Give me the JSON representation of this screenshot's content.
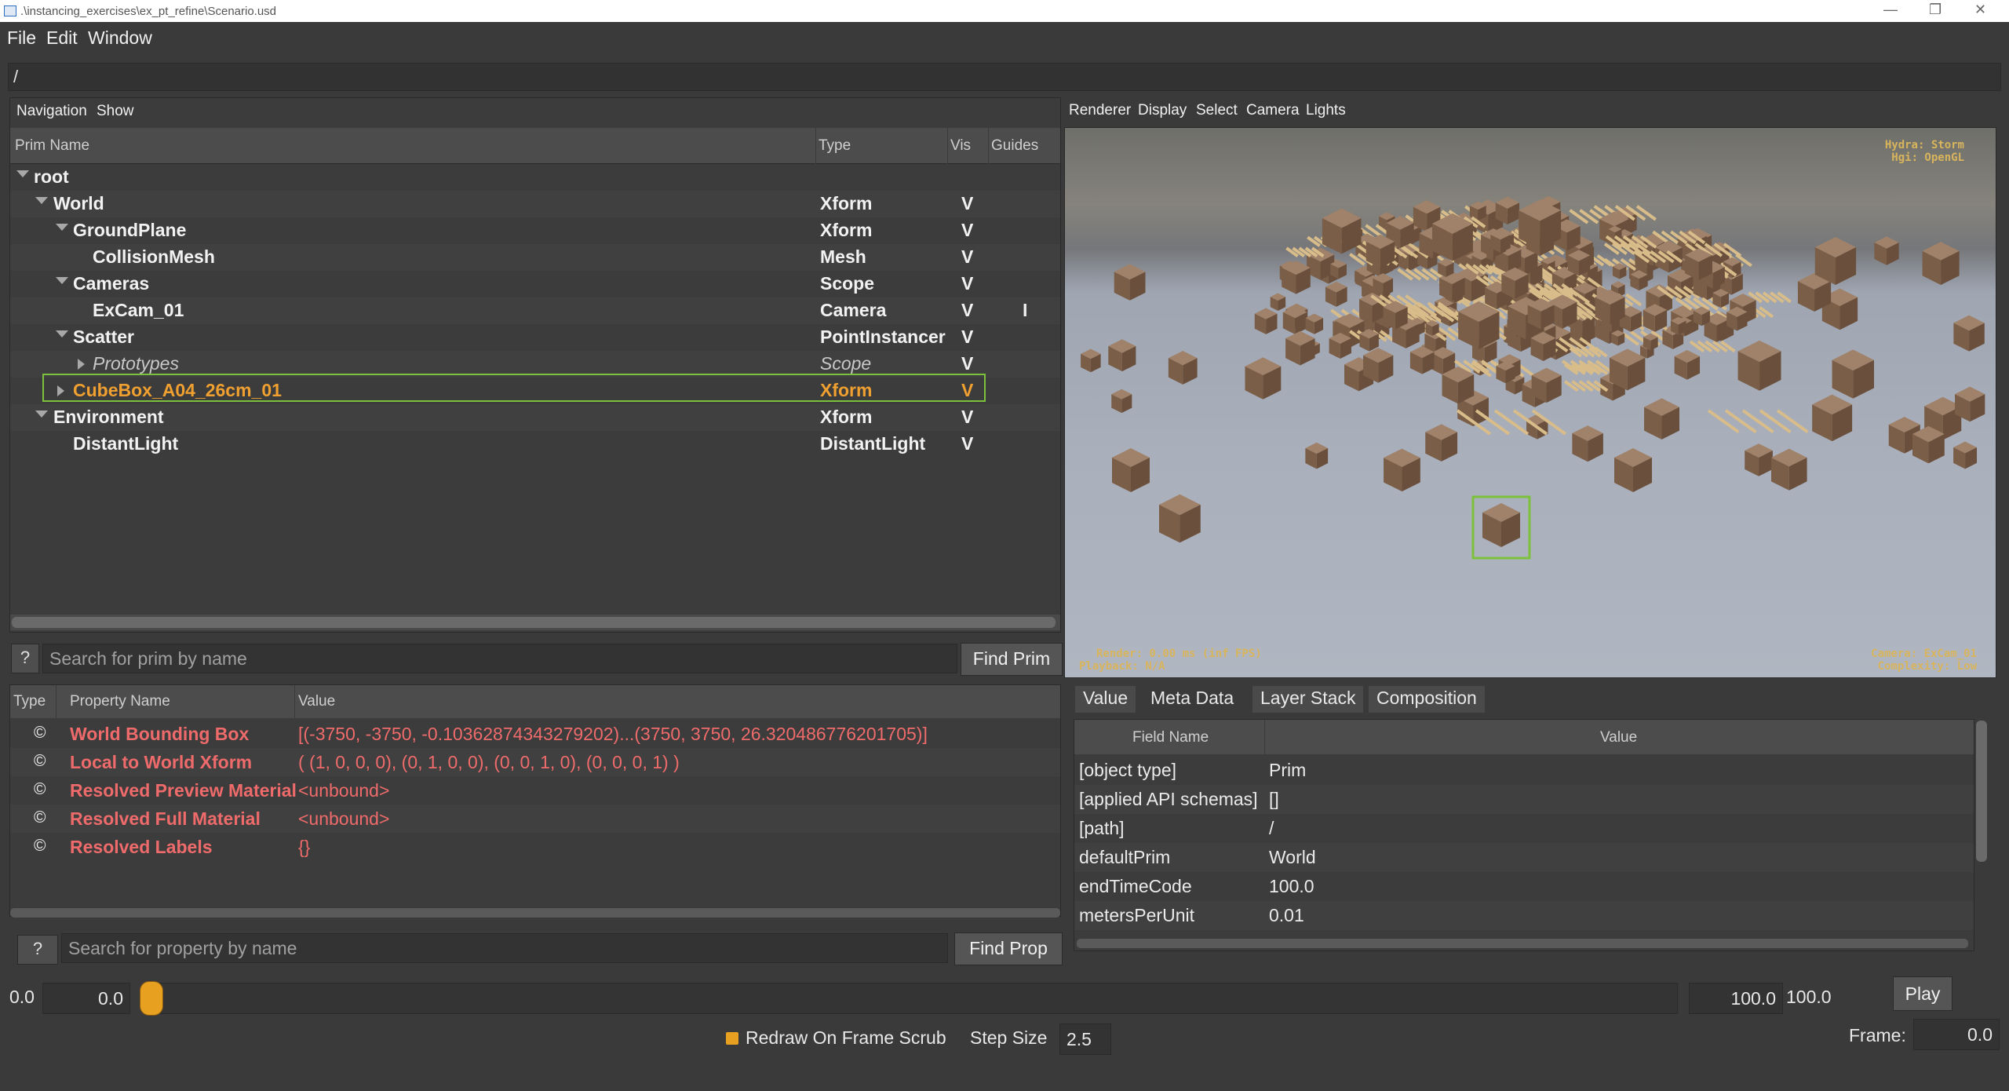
{
  "window": {
    "title": ".\\instancing_exercises\\ex_pt_refine\\Scenario.usd",
    "minimize": "—",
    "maximize": "❐",
    "close": "✕"
  },
  "menubar": {
    "items": [
      "File",
      "Edit",
      "Window"
    ]
  },
  "pathbar": {
    "value": "/"
  },
  "prim_panel": {
    "menu": [
      "Navigation",
      "Show"
    ],
    "headers": {
      "name": "Prim Name",
      "type": "Type",
      "vis": "Vis",
      "guides": "Guides"
    },
    "rows": [
      {
        "name": "root",
        "type": "",
        "vis": "",
        "guide": ""
      },
      {
        "name": "World",
        "type": "Xform",
        "vis": "V",
        "guide": ""
      },
      {
        "name": "GroundPlane",
        "type": "Xform",
        "vis": "V",
        "guide": ""
      },
      {
        "name": "CollisionMesh",
        "type": "Mesh",
        "vis": "V",
        "guide": ""
      },
      {
        "name": "Cameras",
        "type": "Scope",
        "vis": "V",
        "guide": ""
      },
      {
        "name": "ExCam_01",
        "type": "Camera",
        "vis": "V",
        "guide": "I"
      },
      {
        "name": "Scatter",
        "type": "PointInstancer",
        "vis": "V",
        "guide": ""
      },
      {
        "name": "Prototypes",
        "type": "Scope",
        "vis": "V",
        "guide": ""
      },
      {
        "name": "CubeBox_A04_26cm_01",
        "type": "Xform",
        "vis": "V",
        "guide": ""
      },
      {
        "name": "Environment",
        "type": "Xform",
        "vis": "V",
        "guide": ""
      },
      {
        "name": "DistantLight",
        "type": "DistantLight",
        "vis": "V",
        "guide": ""
      }
    ],
    "selected_prim": "CubeBox_A04_26cm_01"
  },
  "prim_search": {
    "help": "?",
    "placeholder": "Search for prim by name",
    "button": "Find Prim"
  },
  "property_panel": {
    "headers": {
      "type": "Type",
      "name": "Property Name",
      "value": "Value"
    },
    "icon_glyph": "©",
    "rows": [
      {
        "name": "World Bounding Box",
        "value": "[(-3750, -3750, -0.10362874343279202)...(3750, 3750, 26.320486776201705)]"
      },
      {
        "name": "Local to World Xform",
        "value": "( (1, 0, 0, 0), (0, 1, 0, 0), (0, 0, 1, 0), (0, 0, 0, 1) )"
      },
      {
        "name": "Resolved Preview Material",
        "value": "<unbound>"
      },
      {
        "name": "Resolved Full Material",
        "value": "<unbound>"
      },
      {
        "name": "Resolved Labels",
        "value": "{}"
      }
    ]
  },
  "prop_search": {
    "help": "?",
    "placeholder": "Search for property by name",
    "button": "Find Prop"
  },
  "viewport": {
    "menu": [
      "Renderer",
      "Display",
      "Select",
      "Camera",
      "Lights"
    ],
    "hud_top_right": [
      "Hydra: Storm",
      "Hgi: OpenGL"
    ],
    "hud_bottom_left": [
      "Render: 0.00 ms (inf FPS)",
      "Playback: N/A"
    ],
    "hud_bottom_right": [
      "Camera: ExCam_01",
      "Complexity: Low"
    ],
    "hud_color": "#d8b45c"
  },
  "meta_tabs": {
    "tabs": [
      "Value",
      "Meta Data",
      "Layer Stack",
      "Composition"
    ],
    "active": "Meta Data"
  },
  "meta_panel": {
    "headers": {
      "field": "Field Name",
      "value": "Value"
    },
    "rows": [
      {
        "field": "[object type]",
        "value": "Prim"
      },
      {
        "field": "[applied API schemas]",
        "value": "[]"
      },
      {
        "field": "[path]",
        "value": "/"
      },
      {
        "field": "defaultPrim",
        "value": "World"
      },
      {
        "field": "endTimeCode",
        "value": "100.0"
      },
      {
        "field": "metersPerUnit",
        "value": "0.01"
      }
    ]
  },
  "timeline": {
    "start_label": "0.0",
    "start_value": "0.0",
    "end_value": "100.0",
    "end_label": "100.0",
    "play": "Play",
    "redraw_label": "Redraw On Frame Scrub",
    "redraw_checked": true,
    "step_label": "Step Size",
    "step_value": "2.5",
    "frame_label": "Frame:",
    "frame_value": "0.0",
    "accent": "#e8a020"
  },
  "colors": {
    "selection_outline": "#7cc13b",
    "selected_text": "#f0a030",
    "property_text": "#ef6b6b"
  }
}
